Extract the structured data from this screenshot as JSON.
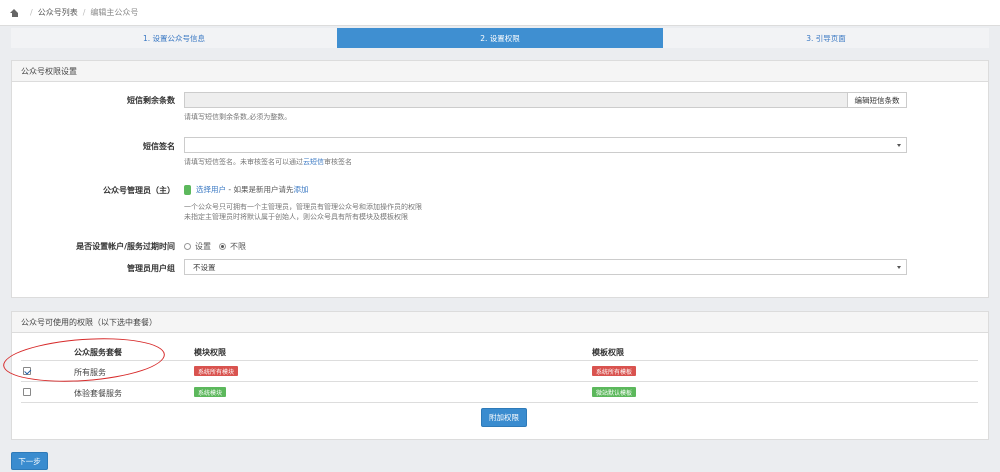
{
  "breadcrumb": {
    "items": [
      "公众号列表",
      "编辑主公众号"
    ]
  },
  "steps": [
    {
      "label": "1. 设置公众号信息",
      "active": false
    },
    {
      "label": "2. 设置权限",
      "active": true
    },
    {
      "label": "3. 引导页面",
      "active": false
    }
  ],
  "permission_panel": {
    "title": "公众号权限设置",
    "sms_count": {
      "label": "短信剩余条数",
      "value": "",
      "edit_button": "编辑短信条数",
      "hint": "请填写短信剩余条数,必须为整数。"
    },
    "sms_sign": {
      "label": "短信签名",
      "value": "",
      "hint_prefix": "请填写短信签名。未审核签名可以通过",
      "hint_link": "云短信",
      "hint_suffix": "审核签名"
    },
    "admin": {
      "label": "公众号管理员（主）",
      "select_link": "选择用户",
      "middle_text": "- 如果是新用户请先",
      "add_link": "添加",
      "hint_line1": "一个公众号只可拥有一个主管理员，管理员有管理公众号和添加操作员的权限",
      "hint_line2": "未指定主管理员时将默认属于创始人，则公众号具有所有模块及模板权限"
    },
    "expire": {
      "label": "是否设置帐户/服务过期时间",
      "options": [
        "设置",
        "不限"
      ],
      "selected": "不限"
    },
    "admin_group": {
      "label": "管理员用户组",
      "value": "不设置"
    }
  },
  "service_panel": {
    "title": "公众号可使用的权限（以下选中套餐）",
    "headers": [
      "公众服务套餐",
      "模块权限",
      "模板权限"
    ],
    "rows": [
      {
        "checked": true,
        "name": "所有服务",
        "module_tag": "系统所有模块",
        "module_color": "#d9534f",
        "template_tag": "系统所有模板",
        "template_color": "#d9534f"
      },
      {
        "checked": false,
        "name": "体验套餐服务",
        "module_tag": "系统模块",
        "module_color": "#5cb85c",
        "template_tag": "微站默认模板",
        "template_color": "#5cb85c"
      }
    ],
    "add_button": "附加权限"
  },
  "footer": {
    "next_button": "下一步"
  },
  "colors": {
    "primary": "#3f8fd1",
    "danger": "#d9534f",
    "success": "#5cb85c",
    "annotation": "#d72a2a"
  }
}
